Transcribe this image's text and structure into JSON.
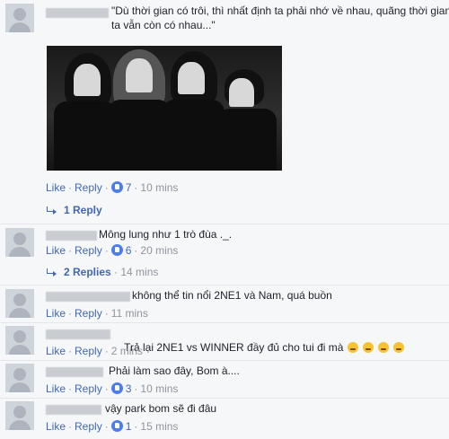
{
  "actions": {
    "like": "Like",
    "reply": "Reply",
    "sep": "·"
  },
  "comments": [
    {
      "text": "\"Dù thời gian có trôi, thì nhất định ta phải nhớ về nhau, quãng thời gian\nta vẫn còn có nhau...\"",
      "likes": "7",
      "time": "10 mins",
      "replies_label": "1 Reply",
      "photo": "black-and-white photo of four women in black outfits"
    },
    {
      "text": "Mông lung như 1 trò đùa ._.",
      "likes": "6",
      "time": "20 mins",
      "replies_label": "2 Replies",
      "replies_time": "14 mins"
    },
    {
      "text": "không thể tin nổi 2NE1 và Nam, quá buồn",
      "time": "11 mins"
    },
    {
      "text": "Trả lại 2NE1 vs WINNER đầy đủ cho tui đi mà",
      "time": "2 mins",
      "emoji": "crying-face"
    },
    {
      "text": "Phải làm sao đây, Bom à....",
      "likes": "3",
      "time": "10 mins"
    },
    {
      "text": "vậy park bom sẽ đi đâu",
      "likes": "1",
      "time": "15 mins"
    }
  ],
  "colors": {
    "link": "#4267b2",
    "meta": "#90949c",
    "background": "#f6f7f9"
  }
}
